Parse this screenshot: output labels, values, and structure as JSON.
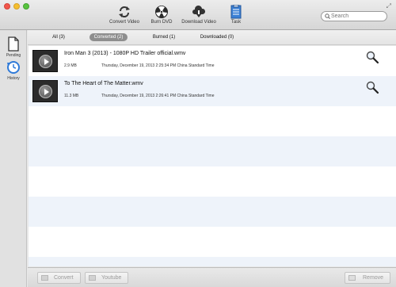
{
  "toolbar": {
    "convert_label": "Convert Video",
    "burn_label": "Burn DVD",
    "download_label": "Download Video",
    "task_label": "Task"
  },
  "search": {
    "placeholder": "Search",
    "value": ""
  },
  "sidebar": {
    "items": [
      {
        "label": "Pending",
        "icon": "document-icon"
      },
      {
        "label": "History",
        "icon": "history-clock-icon"
      }
    ]
  },
  "tabs": [
    {
      "label": "All (3)",
      "active": false
    },
    {
      "label": "Converted (2)",
      "active": true
    },
    {
      "label": "Burned (1)",
      "active": false
    },
    {
      "label": "Downloaded (0)",
      "active": false
    }
  ],
  "files": [
    {
      "name": "Iron Man 3 (2013) - 1080P HD Trailer official.wmv",
      "size": "2.9 MB",
      "date": "Thursday, December 19, 2013 2:25:34 PM China Standard Time"
    },
    {
      "name": "To The Heart of The Matter.wmv",
      "size": "11.3 MB",
      "date": "Thursday, December 19, 2013 2:26:41 PM China Standard Time"
    }
  ],
  "bottom": {
    "convert_label": "Convert",
    "youtube_label": "Youtube",
    "remove_label": "Remove"
  },
  "colors": {
    "accent_blue": "#3a7fd5",
    "active_tab": "#8e8e8e",
    "row_alt": "#eef3fa"
  }
}
